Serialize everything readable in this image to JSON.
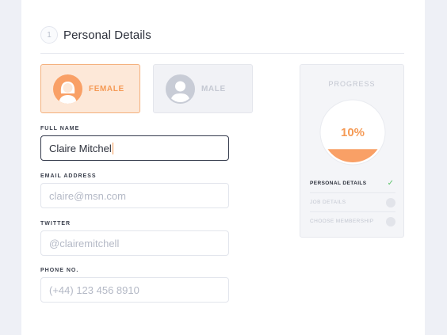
{
  "section": {
    "number": "1",
    "title": "Personal Details"
  },
  "gender": {
    "options": [
      {
        "label": "FEMALE",
        "selected": true
      },
      {
        "label": "MALE",
        "selected": false
      }
    ]
  },
  "form": {
    "full_name": {
      "label": "FULL NAME",
      "value": "Claire Mitchel"
    },
    "email": {
      "label": "EMAIL ADDRESS",
      "placeholder": "claire@msn.com"
    },
    "twitter": {
      "label": "TWITTER",
      "placeholder": "@clairemitchell"
    },
    "phone": {
      "label": "PHONE NO.",
      "placeholder": "(+44) 123 456 8910"
    }
  },
  "progress": {
    "title": "PROGRESS",
    "percent_label": "10%",
    "percent": 10,
    "steps": [
      {
        "label": "PERSONAL DETAILS",
        "done": true
      },
      {
        "label": "JOB DETAILS",
        "done": false
      },
      {
        "label": "CHOOSE MEMBERSHIP",
        "done": false
      }
    ]
  },
  "colors": {
    "accent": "#f59a55",
    "accent_light": "#fde8d8",
    "check": "#5cc46a",
    "text_dark": "#2b2f3a"
  },
  "icons": {
    "female": "female-avatar-icon",
    "male": "male-avatar-icon",
    "check": "check-icon"
  }
}
